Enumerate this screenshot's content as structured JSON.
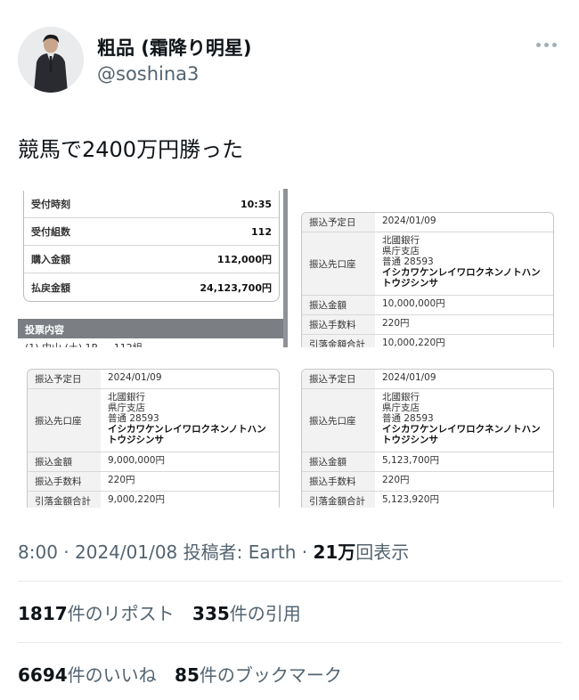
{
  "author": {
    "name": "粗品 (霜降り明星)",
    "handle": "@soshina3"
  },
  "tweet": {
    "text": "競馬で2400万円勝った"
  },
  "media": {
    "receipt": {
      "rows": [
        {
          "label": "受付時刻",
          "value": "10:35"
        },
        {
          "label": "受付組数",
          "value": "112"
        },
        {
          "label": "購入金額",
          "value": "112,000円"
        },
        {
          "label": "払戻金額",
          "value": "24,123,700円"
        }
      ],
      "vote_header": "投票内容",
      "cut_text": "(1)  中山 (土)  1R ...      112組"
    },
    "transfers": [
      {
        "date_label": "振込予定日",
        "date": "2024/01/09",
        "dest_label": "振込先口座",
        "dest": [
          "北國銀行",
          "県庁支店",
          "普通 28593"
        ],
        "dest_name": "イシカワケンレイワロクネンノトハントウジシンサ",
        "amount_label": "振込金額",
        "amount": "10,000,000円",
        "fee_label": "振込手数料",
        "fee": "220円",
        "total_label": "引落金額合計",
        "total": "10,000,220円"
      },
      {
        "date_label": "振込予定日",
        "date": "2024/01/09",
        "dest_label": "振込先口座",
        "dest": [
          "北國銀行",
          "県庁支店",
          "普通 28593"
        ],
        "dest_name": "イシカワケンレイワロクネンノトハントウジシンサ",
        "amount_label": "振込金額",
        "amount": "9,000,000円",
        "fee_label": "振込手数料",
        "fee": "220円",
        "total_label": "引落金額合計",
        "total": "9,000,220円"
      },
      {
        "date_label": "振込予定日",
        "date": "2024/01/09",
        "dest_label": "振込先口座",
        "dest": [
          "北國銀行",
          "県庁支店",
          "普通 28593"
        ],
        "dest_name": "イシカワケンレイワロクネンノトハントウジシンサ",
        "amount_label": "振込金額",
        "amount": "5,123,700円",
        "fee_label": "振込手数料",
        "fee": "220円",
        "total_label": "引落金額合計",
        "total": "5,123,920円"
      }
    ]
  },
  "meta": {
    "time": "8:00",
    "sep1": " · ",
    "date": "2024/01/08",
    "poster": " 投稿者: Earth",
    "sep2": " · ",
    "views_num": "21万",
    "views_label": "回表示"
  },
  "stats": {
    "reposts_num": "1817",
    "reposts_label": "件のリポスト",
    "quotes_num": "335",
    "quotes_label": "件の引用",
    "likes_num": "6694",
    "likes_label": "件のいいね",
    "bookmarks_num": "85",
    "bookmarks_label": "件のブックマーク"
  }
}
